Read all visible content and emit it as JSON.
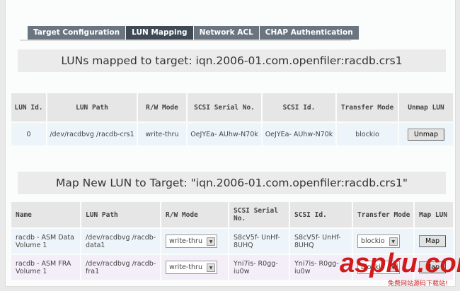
{
  "tabs": [
    "Target Configuration",
    "LUN Mapping",
    "Network ACL",
    "CHAP Authentication"
  ],
  "active_tab": "LUN Mapping",
  "mapped": {
    "title": "LUNs mapped to target: iqn.2006-01.com.openfiler:racdb.crs1",
    "headers": [
      "LUN Id.",
      "LUN Path",
      "R/W Mode",
      "SCSI Serial No.",
      "SCSI Id.",
      "Transfer Mode",
      "Unmap LUN"
    ],
    "rows": [
      {
        "id": "0",
        "path": "/dev/racdbvg /racdb-crs1",
        "mode": "write-thru",
        "serial": "OeJYEa- AUhw-N70k",
        "scsi_id": "OeJYEa- AUhw-N70k",
        "transfer": "blockio",
        "action": "Unmap"
      }
    ]
  },
  "map_new": {
    "title": "Map New LUN to Target: \"iqn.2006-01.com.openfiler:racdb.crs1\"",
    "headers": [
      "Name",
      "LUN Path",
      "R/W Mode",
      "SCSI Serial No.",
      "SCSI Id.",
      "Transfer Mode",
      "Map LUN"
    ],
    "rows": [
      {
        "name": "racdb - ASM Data Volume 1",
        "path": "/dev/racdbvg /racdb-data1",
        "mode": "write-thru",
        "serial": "S8cV5f- UnHf-8UHQ",
        "scsi_id": "S8cV5f- UnHf-8UHQ",
        "transfer": "blockio",
        "action": "Map"
      },
      {
        "name": "racdb - ASM FRA Volume 1",
        "path": "/dev/racdbvg /racdb-fra1",
        "mode": "write-thru",
        "serial": "Yni7is- R0gg-iu0w",
        "scsi_id": "Yni7is- R0gg-iu0w",
        "transfer": "blockio",
        "action": "Map"
      }
    ]
  },
  "watermark": {
    "logo": "aspku.com",
    "slogan": "免费网站源码下载站!"
  }
}
